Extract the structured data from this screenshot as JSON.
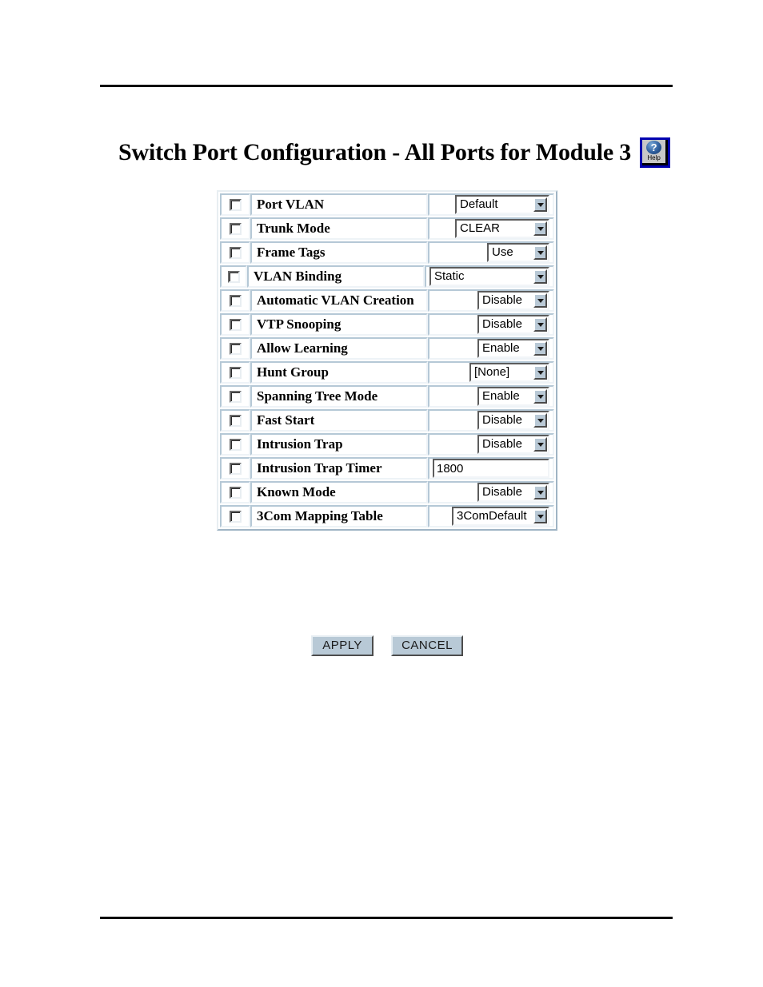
{
  "page": {
    "title": "Switch Port Configuration - All Ports for Module 3",
    "help_icon_glyph": "?",
    "help_icon_label": "Help",
    "help_icon_name": "help-question-icon"
  },
  "colors": {
    "help_border": "#0000b0",
    "button_face": "#b8c9d6",
    "cell_border": "#b5c8d6",
    "text": "#000000"
  },
  "table": {
    "rows": [
      {
        "checkbox_checked": false,
        "label": "Port VLAN",
        "control": "select",
        "value": "Default",
        "width_class": "w-default"
      },
      {
        "checkbox_checked": false,
        "label": "Trunk Mode",
        "control": "select",
        "value": "CLEAR",
        "width_class": "w-clear"
      },
      {
        "checkbox_checked": false,
        "label": "Frame Tags",
        "control": "select",
        "value": "Use",
        "width_class": "w-use"
      },
      {
        "checkbox_checked": false,
        "label": "VLAN Binding",
        "control": "select",
        "value": "Static",
        "width_class": "w-static"
      },
      {
        "checkbox_checked": false,
        "label": "Automatic VLAN Creation",
        "control": "select",
        "value": "Disable",
        "width_class": "w-dis"
      },
      {
        "checkbox_checked": false,
        "label": "VTP Snooping",
        "control": "select",
        "value": "Disable",
        "width_class": "w-dis"
      },
      {
        "checkbox_checked": false,
        "label": "Allow Learning",
        "control": "select",
        "value": "Enable",
        "width_class": "w-en"
      },
      {
        "checkbox_checked": false,
        "label": "Hunt Group",
        "control": "select",
        "value": "[None]",
        "width_class": "w-none"
      },
      {
        "checkbox_checked": false,
        "label": "Spanning Tree Mode",
        "control": "select",
        "value": "Enable",
        "width_class": "w-en"
      },
      {
        "checkbox_checked": false,
        "label": "Fast Start",
        "control": "select",
        "value": "Disable",
        "width_class": "w-dis"
      },
      {
        "checkbox_checked": false,
        "label": "Intrusion Trap",
        "control": "select",
        "value": "Disable",
        "width_class": "w-dis"
      },
      {
        "checkbox_checked": false,
        "label": "Intrusion Trap Timer",
        "control": "text",
        "value": "1800",
        "width_class": ""
      },
      {
        "checkbox_checked": false,
        "label": "Known Mode",
        "control": "select",
        "value": "Disable",
        "width_class": "w-dis"
      },
      {
        "checkbox_checked": false,
        "label": "3Com Mapping Table",
        "control": "select",
        "value": "3ComDefault",
        "width_class": "w-3com"
      }
    ]
  },
  "buttons": {
    "apply_label": "APPLY",
    "cancel_label": "CANCEL"
  }
}
